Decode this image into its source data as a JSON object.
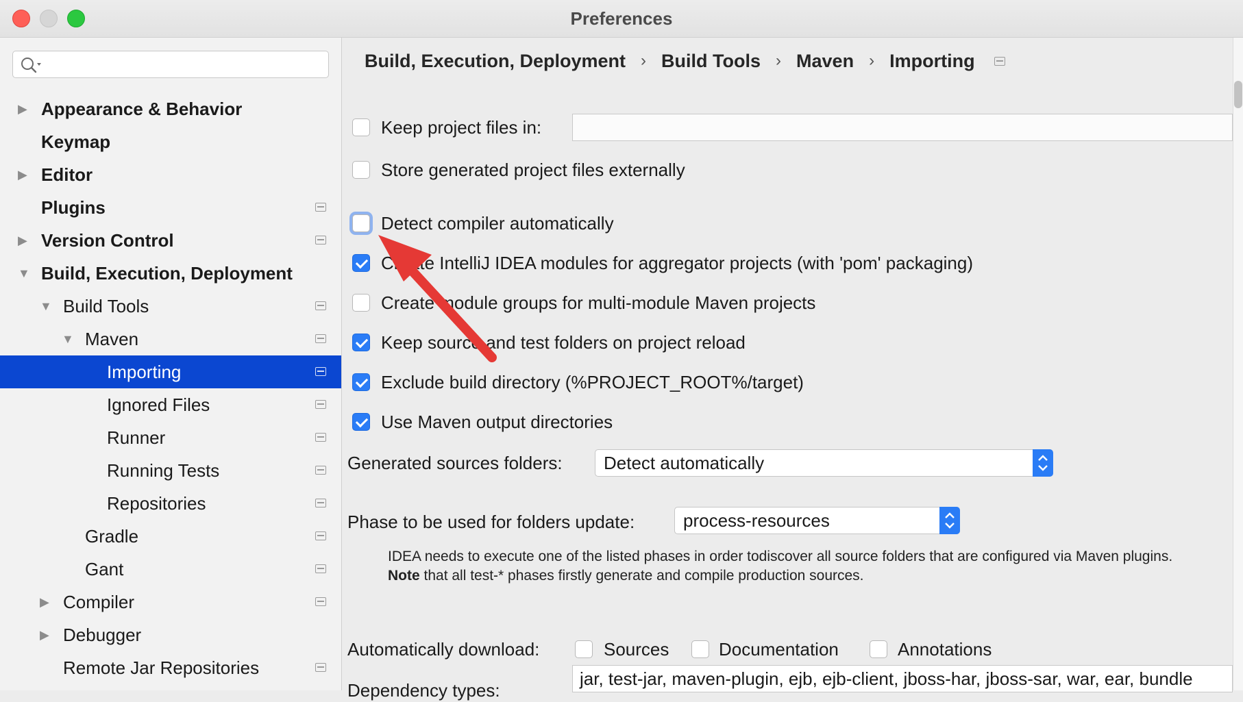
{
  "window": {
    "title": "Preferences"
  },
  "search": {
    "placeholder": ""
  },
  "sidebar": {
    "items": [
      {
        "label": "Appearance & Behavior",
        "bold": true,
        "arrow": "right",
        "project_icon": false
      },
      {
        "label": "Keymap",
        "bold": true,
        "arrow": "none",
        "project_icon": false
      },
      {
        "label": "Editor",
        "bold": true,
        "arrow": "right",
        "project_icon": false
      },
      {
        "label": "Plugins",
        "bold": true,
        "arrow": "none",
        "project_icon": true
      },
      {
        "label": "Version Control",
        "bold": true,
        "arrow": "right",
        "project_icon": true
      },
      {
        "label": "Build, Execution, Deployment",
        "bold": true,
        "arrow": "down",
        "project_icon": false
      },
      {
        "label": "Build Tools",
        "bold": false,
        "arrow": "down",
        "project_icon": true
      },
      {
        "label": "Maven",
        "bold": false,
        "arrow": "down",
        "project_icon": true
      },
      {
        "label": "Importing",
        "bold": false,
        "arrow": "none",
        "project_icon": true,
        "selected": true
      },
      {
        "label": "Ignored Files",
        "bold": false,
        "arrow": "none",
        "project_icon": true
      },
      {
        "label": "Runner",
        "bold": false,
        "arrow": "none",
        "project_icon": true
      },
      {
        "label": "Running Tests",
        "bold": false,
        "arrow": "none",
        "project_icon": true
      },
      {
        "label": "Repositories",
        "bold": false,
        "arrow": "none",
        "project_icon": true
      },
      {
        "label": "Gradle",
        "bold": false,
        "arrow": "none",
        "project_icon": true
      },
      {
        "label": "Gant",
        "bold": false,
        "arrow": "none",
        "project_icon": true
      },
      {
        "label": "Compiler",
        "bold": false,
        "arrow": "right",
        "project_icon": true
      },
      {
        "label": "Debugger",
        "bold": false,
        "arrow": "right",
        "project_icon": false
      },
      {
        "label": "Remote Jar Repositories",
        "bold": false,
        "arrow": "none",
        "project_icon": true
      }
    ]
  },
  "breadcrumb": [
    "Build, Execution, Deployment",
    "Build Tools",
    "Maven",
    "Importing"
  ],
  "breadcrumb_separator": "›",
  "options": {
    "keep_project_files": {
      "label": "Keep project files in:",
      "checked": false,
      "value": ""
    },
    "store_generated": {
      "label": "Store generated project files externally",
      "checked": false
    },
    "detect_compiler": {
      "label": "Detect compiler automatically",
      "checked": false,
      "focused": true
    },
    "create_modules_aggregator": {
      "label": "Create IntelliJ IDEA modules for aggregator projects (with 'pom' packaging)",
      "checked": true
    },
    "create_module_groups": {
      "label": "Create module groups for multi-module Maven projects",
      "checked": false
    },
    "keep_source_folders": {
      "label": "Keep source and test folders on project reload",
      "checked": true
    },
    "exclude_build_dir": {
      "label": "Exclude build directory (%PROJECT_ROOT%/target)",
      "checked": true
    },
    "use_maven_output": {
      "label": "Use Maven output directories",
      "checked": true
    }
  },
  "generated_sources": {
    "label": "Generated sources folders:",
    "value": "Detect automatically"
  },
  "phase": {
    "label": "Phase to be used for folders update:",
    "value": "process-resources"
  },
  "phase_note": {
    "line1": "IDEA needs to execute one of the listed phases in order todiscover all source folders that are configured via Maven plugins.",
    "line2_bold": "Note",
    "line2_rest": " that all test-* phases firstly generate and compile production sources."
  },
  "auto_download": {
    "label": "Automatically download:",
    "sources": {
      "label": "Sources",
      "checked": false
    },
    "documentation": {
      "label": "Documentation",
      "checked": false
    },
    "annotations": {
      "label": "Annotations",
      "checked": false
    }
  },
  "dependency_types": {
    "label": "Dependency types:",
    "value": "jar, test-jar, maven-plugin, ejb, ejb-client, jboss-har, jboss-sar, war, ear, bundle"
  },
  "colors": {
    "selection": "#0b47d1",
    "checkbox_checked": "#2a7cf6",
    "annotation_arrow": "#e53935"
  }
}
